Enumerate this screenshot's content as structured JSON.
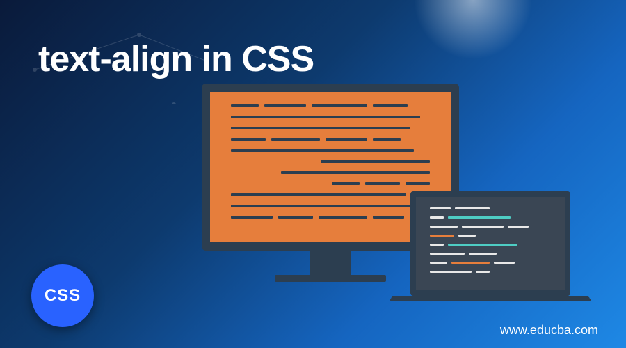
{
  "title": "text-align in CSS",
  "badge_text": "CSS",
  "website_url": "www.educba.com",
  "icons": {
    "css_badge": "css-badge",
    "monitor": "monitor-illustration",
    "laptop": "laptop-illustration"
  }
}
